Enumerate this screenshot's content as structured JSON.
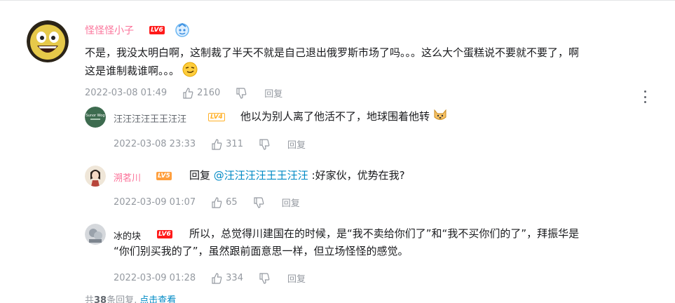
{
  "main_comment": {
    "username": "怪怪怪小子",
    "level": "LV6",
    "text_line1": "不是，我没太明白啊，这制裁了半天不就是自己退出俄罗斯市场了吗。。。这么大个蛋糕说不要就不要了，啊",
    "text_line2": "这是谁制裁谁啊。。。",
    "emoji": "smirk-emoji",
    "time": "2022-03-08 01:49",
    "likes": "2160",
    "reply_label": "回复"
  },
  "replies": [
    {
      "username": "汪汪汪汪王王汪汪",
      "level": "LV4",
      "text": "他以为别人离了他活不了，地球围着他转",
      "emoji": "dog-emoji",
      "time": "2022-03-08 23:33",
      "likes": "311",
      "reply_label": "回复",
      "avatar_text": "Sunor Wog"
    },
    {
      "username": "溯茗川",
      "level": "LV5",
      "reply_prefix": "回复",
      "mention": "@汪汪汪汪王王汪汪",
      "text": ":好家伙，优势在我?",
      "time": "2022-03-09 01:07",
      "likes": "65",
      "reply_label": "回复"
    },
    {
      "username": "冰的块",
      "level": "LV6",
      "text_line1": "所以，总觉得川建国在的时候，是“我不卖给你们了”和“我不买你们的了”，拜振华是",
      "text_line2": "“你们别买我的了”，虽然跟前面意思一样，但立场怪怪的感觉。",
      "time": "2022-03-09 01:28",
      "likes": "334",
      "reply_label": "回复"
    }
  ],
  "footer": {
    "prefix": "共",
    "count": "38",
    "suffix": "条回复,",
    "link": "点击查看"
  },
  "colors": {
    "username_pink": "#fb7299",
    "link_blue": "#008ac5",
    "meta_grey": "#9499a0"
  }
}
